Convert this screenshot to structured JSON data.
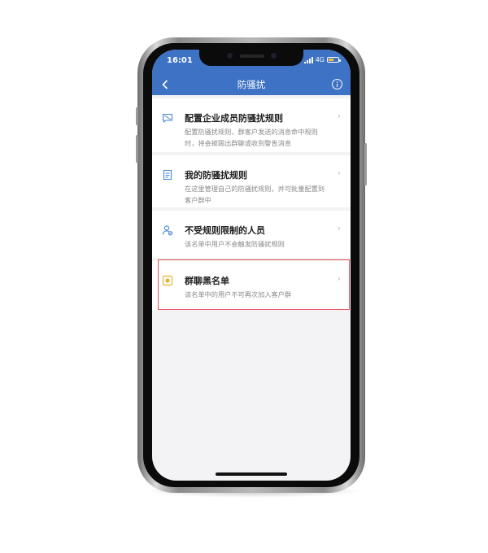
{
  "status_bar": {
    "time": "16:01",
    "network": "4G"
  },
  "header": {
    "title": "防骚扰",
    "back_icon": "chevron-left-icon",
    "info_icon": "info-icon"
  },
  "items": [
    {
      "title": "配置企业成员防骚扰规则",
      "desc": "配置防骚扰规则，群客户发送的消息命中规则时，将会被踢出群聊或收到警告消息",
      "icon": "message-rule-icon"
    },
    {
      "title": "我的防骚扰规则",
      "desc": "在这里管理自己的防骚扰规则，并可批量配置到客户群中",
      "icon": "document-icon"
    },
    {
      "title": "不受规则限制的人员",
      "desc": "该名单中用户不会触发防骚扰规则",
      "icon": "user-exempt-icon"
    },
    {
      "title": "群聊黑名单",
      "desc": "该名单中的用户不可再次加入客户群",
      "icon": "blacklist-icon",
      "highlighted": true
    }
  ],
  "colors": {
    "header": "#3d72c4",
    "icon_blue": "#4a86d6",
    "icon_yellow": "#e7b334",
    "highlight": "#e5505a"
  }
}
